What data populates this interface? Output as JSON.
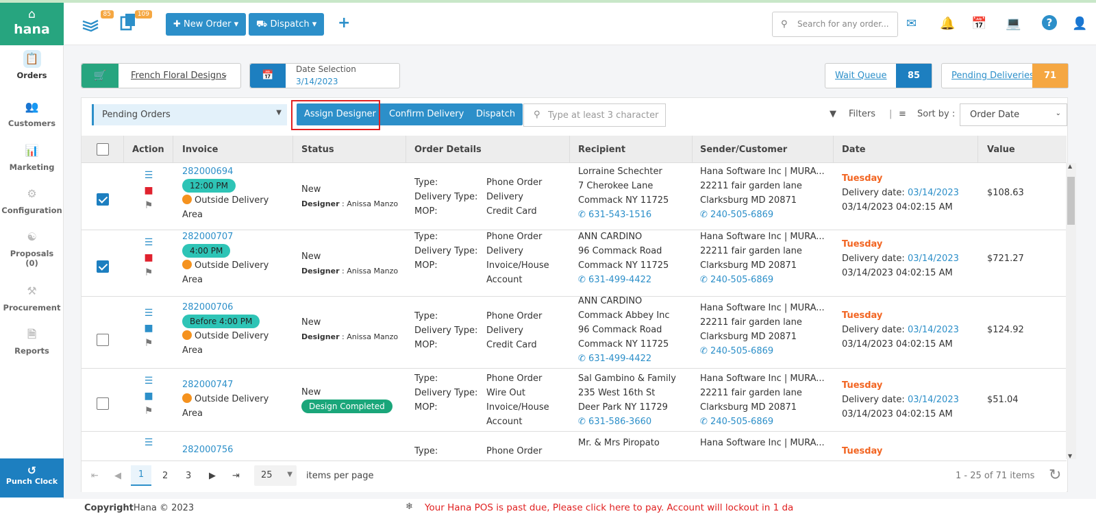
{
  "app": {
    "logo_text": "hana"
  },
  "header": {
    "badge_orders": "85",
    "badge_tasks": "109",
    "new_order": "New Order",
    "dispatch": "Dispatch",
    "search_placeholder": "Search for any order..."
  },
  "sidebar": {
    "items": [
      {
        "label": "Orders",
        "icon": "orders-icon"
      },
      {
        "label": "Customers",
        "icon": "customers-icon"
      },
      {
        "label": "Marketing",
        "icon": "marketing-icon"
      },
      {
        "label": "Configuration",
        "icon": "gear-icon"
      },
      {
        "label": "Proposals",
        "sub": "(0)",
        "icon": "proposals-icon"
      },
      {
        "label": "Procurement",
        "icon": "procurement-icon"
      },
      {
        "label": "Reports",
        "icon": "reports-icon"
      }
    ],
    "punch_clock": "Punch Clock"
  },
  "store": {
    "name": "French Floral Designs"
  },
  "date_selection": {
    "label": "Date Selection",
    "value": "3/14/2023"
  },
  "wait_queue": {
    "label": "Wait Queue",
    "count": "85"
  },
  "pending_deliveries": {
    "label": "Pending Deliveries",
    "count": "71"
  },
  "toolbar": {
    "filter_value": "Pending Orders",
    "assign_designer": "Assign Designer",
    "confirm_delivery": "Confirm Delivery",
    "dispatch": "Dispatch",
    "type_placeholder": "Type at least 3 characters",
    "filters": "Filters",
    "sort_by": "Sort by :",
    "sort_value": "Order Date"
  },
  "table": {
    "headers": {
      "action": "Action",
      "invoice": "Invoice",
      "status": "Status",
      "order_details": "Order Details",
      "recipient": "Recipient",
      "sender": "Sender/Customer",
      "date": "Date",
      "value": "Value"
    },
    "detail_labels": {
      "type": "Type:",
      "delivery_type": "Delivery Type:",
      "mop": "MOP:"
    },
    "designer_label": "Designer",
    "rows": [
      {
        "checked": true,
        "invoice": "282000694",
        "time": "12:00 PM",
        "area": "Outside Delivery",
        "area2": "Area",
        "status": "New",
        "designer": "Anissa Manzo",
        "type": "Phone Order",
        "delivery_type": "Delivery",
        "mop": "Credit Card",
        "mop2": "",
        "rec1": "Lorraine Schechter",
        "rec2": "7 Cherokee Lane",
        "rec3": "Commack NY 11725",
        "rec4": "",
        "phone": "631-543-1516",
        "s1": "Hana Software Inc | MURA...",
        "s2": "22211 fair garden lane",
        "s3": "Clarksburg MD 20871",
        "sphone": "240-505-6869",
        "day": "Tuesday",
        "dlabel": "Delivery date:",
        "ddate": "03/14/2023",
        "ts": "03/14/2023 04:02:15 AM",
        "value": "$108.63"
      },
      {
        "checked": true,
        "invoice": "282000707",
        "time": "4:00 PM",
        "area": "Outside Delivery",
        "area2": "Area",
        "status": "New",
        "designer": "Anissa Manzo",
        "type": "Phone Order",
        "delivery_type": "Delivery",
        "mop": "Invoice/House",
        "mop2": "Account",
        "rec1": "ANN CARDINO",
        "rec2": "96 Commack Road",
        "rec3": "Commack NY 11725",
        "rec4": "",
        "phone": "631-499-4422",
        "s1": "Hana Software Inc | MURA...",
        "s2": "22211 fair garden lane",
        "s3": "Clarksburg MD 20871",
        "sphone": "240-505-6869",
        "day": "Tuesday",
        "dlabel": "Delivery date:",
        "ddate": "03/14/2023",
        "ts": "03/14/2023 04:02:15 AM",
        "value": "$721.27"
      },
      {
        "checked": false,
        "invoice": "282000706",
        "time": "Before 4:00 PM",
        "area": "Outside Delivery",
        "area2": "Area",
        "status": "New",
        "designer": "Anissa Manzo",
        "type": "Phone Order",
        "delivery_type": "Delivery",
        "mop": "Credit Card",
        "mop2": "",
        "rec1": "ANN CARDINO",
        "rec2": "Commack Abbey Inc",
        "rec3": "96 Commack Road",
        "rec4": "Commack NY 11725",
        "phone": "631-499-4422",
        "s1": "Hana Software Inc | MURA...",
        "s2": "22211 fair garden lane",
        "s3": "Clarksburg MD 20871",
        "sphone": "240-505-6869",
        "day": "Tuesday",
        "dlabel": "Delivery date:",
        "ddate": "03/14/2023",
        "ts": "03/14/2023 04:02:15 AM",
        "value": "$124.92"
      },
      {
        "checked": false,
        "invoice": "282000747",
        "time": "",
        "area": "Outside Delivery",
        "area2": "Area",
        "status": "New",
        "designer_badge": "Design Completed",
        "type": "Phone Order",
        "delivery_type": "Wire Out",
        "mop": "Invoice/House",
        "mop2": "Account",
        "rec1": "Sal Gambino & Family",
        "rec2": "235 West 16th St",
        "rec3": "Deer Park NY 11729",
        "rec4": "",
        "phone": "631-586-3660",
        "s1": "Hana Software Inc | MURA...",
        "s2": "22211 fair garden lane",
        "s3": "Clarksburg MD 20871",
        "sphone": "240-505-6869",
        "day": "Tuesday",
        "dlabel": "Delivery date:",
        "ddate": "03/14/2023",
        "ts": "03/14/2023 04:02:15 AM",
        "value": "$51.04"
      },
      {
        "invoice": "282000756",
        "type": "Phone Order",
        "rec1": "Mr. & Mrs Piropato",
        "s1": "Hana Software Inc | MURA...",
        "day": "Tuesday"
      }
    ]
  },
  "pager": {
    "pages": [
      "1",
      "2",
      "3"
    ],
    "page_size": "25",
    "items_per_page": "items per page",
    "summary": "1 - 25 of 71 items"
  },
  "footer": {
    "copyright_bold": "Copyright",
    "copyright": "Hana © 2023",
    "warning": "Your Hana POS is past due, Please click here to pay. Account will lockout in 1 da"
  }
}
